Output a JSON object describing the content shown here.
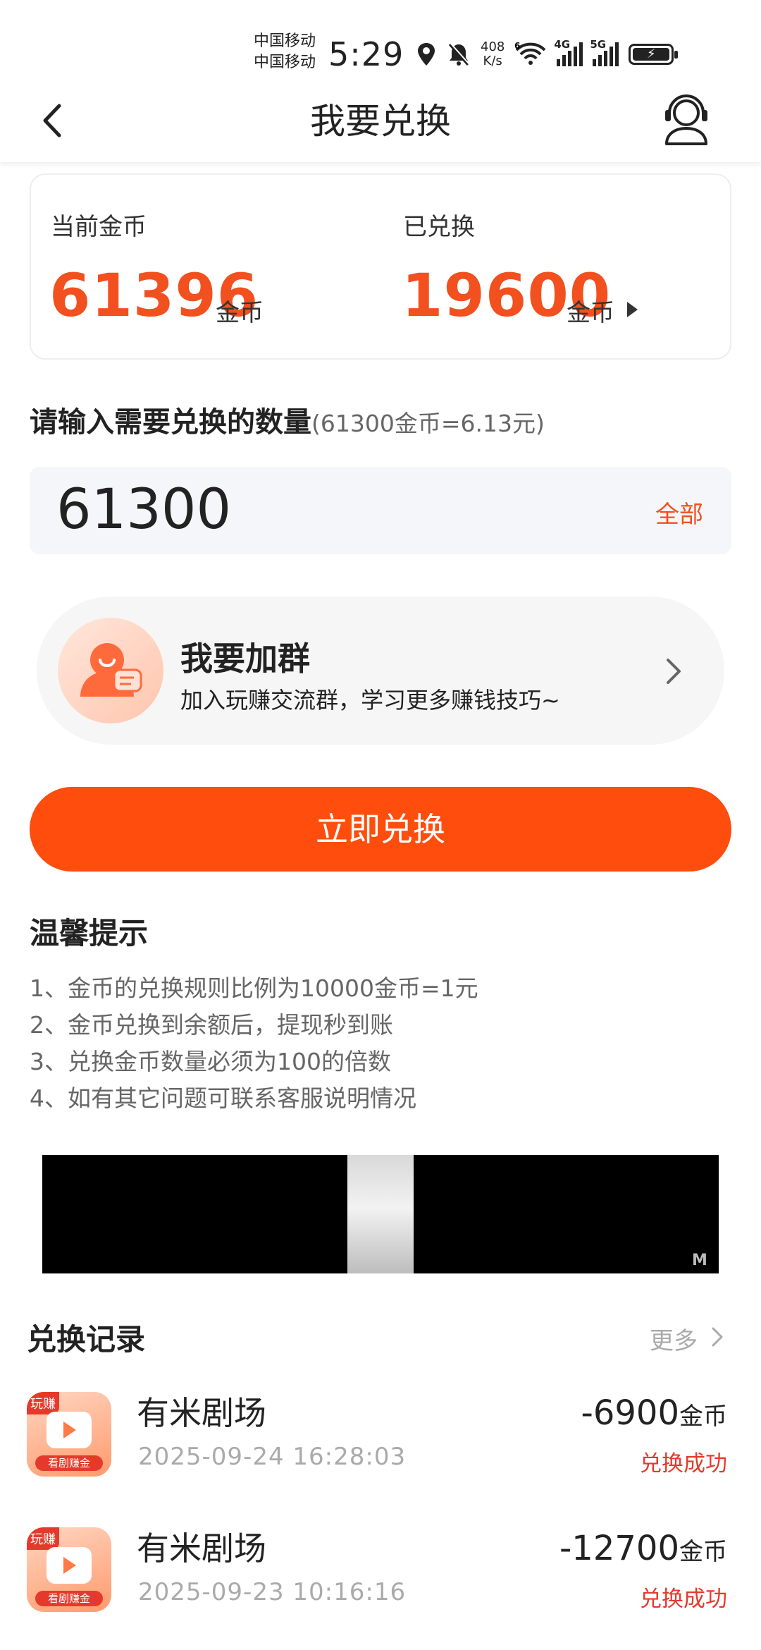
{
  "status_bar": {
    "carrier_1": "中国移动",
    "carrier_2": "中国移动",
    "time": "5:29",
    "net_speed_value": "408",
    "net_speed_unit": "K/s",
    "signal_1_label": "4G",
    "signal_2_label": "5G",
    "wifi_label": "6"
  },
  "nav": {
    "title": "我要兑换"
  },
  "coins": {
    "current_label": "当前金币",
    "current_value": "61396",
    "current_unit": "金币",
    "exchanged_label": "已兑换",
    "exchanged_value": "19600",
    "exchanged_unit": "金币"
  },
  "input": {
    "label": "请输入需要兑换的数量",
    "hint": "(61300金币=6.13元)",
    "value": "61300",
    "all_label": "全部"
  },
  "group": {
    "title": "我要加群",
    "subtitle": "加入玩赚交流群，学习更多赚钱技巧~"
  },
  "submit_label": "立即兑换",
  "tips": {
    "title": "温馨提示",
    "items": [
      "1、金币的兑换规则比例为10000金币=1元",
      "2、金币兑换到余额后，提现秒到账",
      "3、兑换金币数量必须为100的倍数",
      "4、如有其它问题可联系客服说明情况"
    ]
  },
  "records": {
    "title": "兑换记录",
    "more_label": "更多",
    "items": [
      {
        "app_name": "有米剧场",
        "date": "2025-09-24 16:28:03",
        "amount": "-6900",
        "unit": "金币",
        "status": "兑换成功",
        "icon_tag": "玩赚",
        "icon_footer": "看剧赚金"
      },
      {
        "app_name": "有米剧场",
        "date": "2025-09-23 10:16:16",
        "amount": "-12700",
        "unit": "金币",
        "status": "兑换成功",
        "icon_tag": "玩赚",
        "icon_footer": "看剧赚金"
      }
    ]
  },
  "colors": {
    "accent": "#fe4d0c",
    "coin_orange": "#f2501e",
    "success_red": "#e53a2b"
  }
}
